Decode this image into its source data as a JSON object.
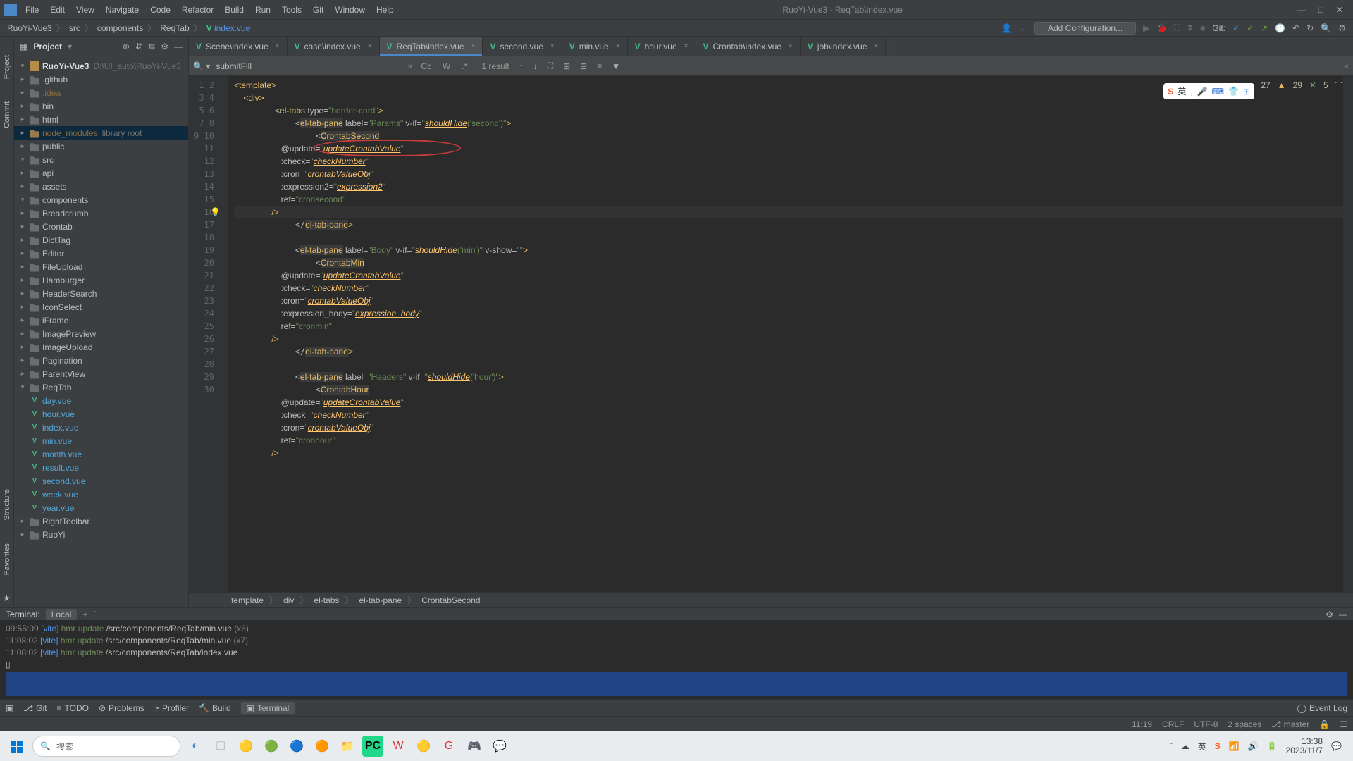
{
  "app_title": "RuoYi-Vue3 - ReqTab\\index.vue",
  "menus": [
    "File",
    "Edit",
    "View",
    "Navigate",
    "Code",
    "Refactor",
    "Build",
    "Run",
    "Tools",
    "Git",
    "Window",
    "Help"
  ],
  "nav": {
    "project": "RuoYi-Vue3",
    "p1": "src",
    "p2": "components",
    "p3": "ReqTab",
    "file": "index.vue",
    "addconf": "Add Configuration...",
    "git": "Git:"
  },
  "proj_header": "Project",
  "tree": {
    "root": "RuoYi-Vue3",
    "root_hint": "D:\\UI_auto\\RuoYi-Vue3",
    "github": ".github",
    "idea": ".idea",
    "bin": "bin",
    "html": "html",
    "nm": "node_modules",
    "nm_hint": "library root",
    "public": "public",
    "src": "src",
    "api": "api",
    "assets": "assets",
    "components": "components",
    "c": [
      "Breadcrumb",
      "Crontab",
      "DictTag",
      "Editor",
      "FileUpload",
      "Hamburger",
      "HeaderSearch",
      "IconSelect",
      "iFrame",
      "ImagePreview",
      "ImageUpload",
      "Pagination",
      "ParentView",
      "ReqTab"
    ],
    "reqtab_files": [
      "day.vue",
      "hour.vue",
      "index.vue",
      "min.vue",
      "month.vue",
      "result.vue",
      "second.vue",
      "week.vue",
      "year.vue"
    ],
    "rt": "RightToolbar",
    "ruoyi": "RuoYi"
  },
  "tabs": [
    "Scene\\index.vue",
    "case\\index.vue",
    "ReqTab\\index.vue",
    "second.vue",
    "min.vue",
    "hour.vue",
    "Crontab\\index.vue",
    "job\\index.vue"
  ],
  "tabs_active": 2,
  "find": {
    "query": "submitFill",
    "result": "1 result"
  },
  "warn": {
    "a": "27",
    "b": "29",
    "c": "5"
  },
  "breadcrumb2": [
    "template",
    "div",
    "el-tabs",
    "el-tab-pane",
    "CrontabSecond"
  ],
  "code_lines": 30,
  "code": {
    "l1": "<template>",
    "l2": "    <div>",
    "l3p": "        <",
    "l3a": "el-tabs",
    "l3b": " type=",
    "l3c": "\"border-card\"",
    "l3d": ">",
    "l4p": "            <",
    "l4a": "el-tab-pane",
    "l4b": " label=",
    "l4c": "\"Params\"",
    "l4d": " v-if=",
    "l4e": "\"",
    "l4f": "shouldHide",
    "l4g": "('second')\"",
    "l4h": ">",
    "l5p": "                <",
    "l5a": "CrontabSecond",
    "l6p": "                    @update=",
    "l6a": "\"",
    "l6b": "updateCrontabValue",
    "l6c": "\"",
    "l7p": "                    :check=",
    "l7a": "\"",
    "l7b": "checkNumber",
    "l7c": "\"",
    "l8p": "                    :cron=",
    "l8a": "\"",
    "l8b": "crontabValueObj",
    "l8c": "\"",
    "l9p": "                    :expression2=",
    "l9a": "\"",
    "l9b": "expression2",
    "l9c": "\"",
    "l10p": "                    ref=",
    "l10a": "\"cronsecond\"",
    "l11p": "                />",
    "l12p": "            </",
    "l12a": "el-tab-pane",
    "l12b": ">",
    "l13": "",
    "l14p": "            <",
    "l14a": "el-tab-pane",
    "l14b": " label=",
    "l14c": "\"Body\"",
    "l14d": " v-if=",
    "l14e": "\"",
    "l14f": "shouldHide",
    "l14g": "('min')\"",
    "l14h": " v-show=",
    "l14i": "\"\"",
    "l14j": ">",
    "l15p": "                <",
    "l15a": "CrontabMin",
    "l16p": "                    @update=",
    "l16a": "\"",
    "l16b": "updateCrontabValue",
    "l16c": "\"",
    "l17p": "                    :check=",
    "l17a": "\"",
    "l17b": "checkNumber",
    "l17c": "\"",
    "l18p": "                    :cron=",
    "l18a": "\"",
    "l18b": "crontabValueObj",
    "l18c": "\"",
    "l19p": "                    :expression_body=",
    "l19a": "\"",
    "l19b": "expression_body",
    "l19c": "\"",
    "l20p": "                    ref=",
    "l20a": "\"cronmin\"",
    "l21p": "                />",
    "l22p": "            </",
    "l22a": "el-tab-pane",
    "l22b": ">",
    "l23": "",
    "l24p": "            <",
    "l24a": "el-tab-pane",
    "l24b": " label=",
    "l24c": "\"Headers\"",
    "l24d": " v-if=",
    "l24e": "\"",
    "l24f": "shouldHide",
    "l24g": "('hour')\"",
    "l24h": ">",
    "l25p": "                <",
    "l25a": "CrontabHour",
    "l26p": "                    @update=",
    "l26a": "\"",
    "l26b": "updateCrontabValue",
    "l26c": "\"",
    "l27p": "                    :check=",
    "l27a": "\"",
    "l27b": "checkNumber",
    "l27c": "\"",
    "l28p": "                    :cron=",
    "l28a": "\"",
    "l28b": "crontabValueObj",
    "l28c": "\"",
    "l29p": "                    ref=",
    "l29a": "\"cronhour\"",
    "l30p": "                />"
  },
  "terminal": {
    "title": "Terminal:",
    "tab": "Local",
    "lines": [
      {
        "ts": "09:55:09",
        "tag": "[vite]",
        "txt": "hmr update",
        "path": "/src/components/ReqTab/min.vue",
        "xn": "(x6)"
      },
      {
        "ts": "11:08:02",
        "tag": "[vite]",
        "txt": "hmr update",
        "path": "/src/components/ReqTab/min.vue",
        "xn": "(x7)"
      },
      {
        "ts": "11:08:02",
        "tag": "[vite]",
        "txt": "hmr update",
        "path": "/src/components/ReqTab/index.vue",
        "xn": ""
      }
    ]
  },
  "tool_bottom": {
    "git": "Git",
    "todo": "TODO",
    "problems": "Problems",
    "profiler": "Profiler",
    "build": "Build",
    "terminal": "Terminal",
    "eventlog": "Event Log"
  },
  "status": {
    "pos": "11:19",
    "crlf": "CRLF",
    "enc": "UTF-8",
    "indent": "2 spaces",
    "branch": "master"
  },
  "left_tabs": [
    "Project",
    "Commit",
    "Structure",
    "Favorites"
  ],
  "taskbar": {
    "search": "搜索",
    "time": "13:38",
    "date": "2023/11/7",
    "ime": "英"
  }
}
